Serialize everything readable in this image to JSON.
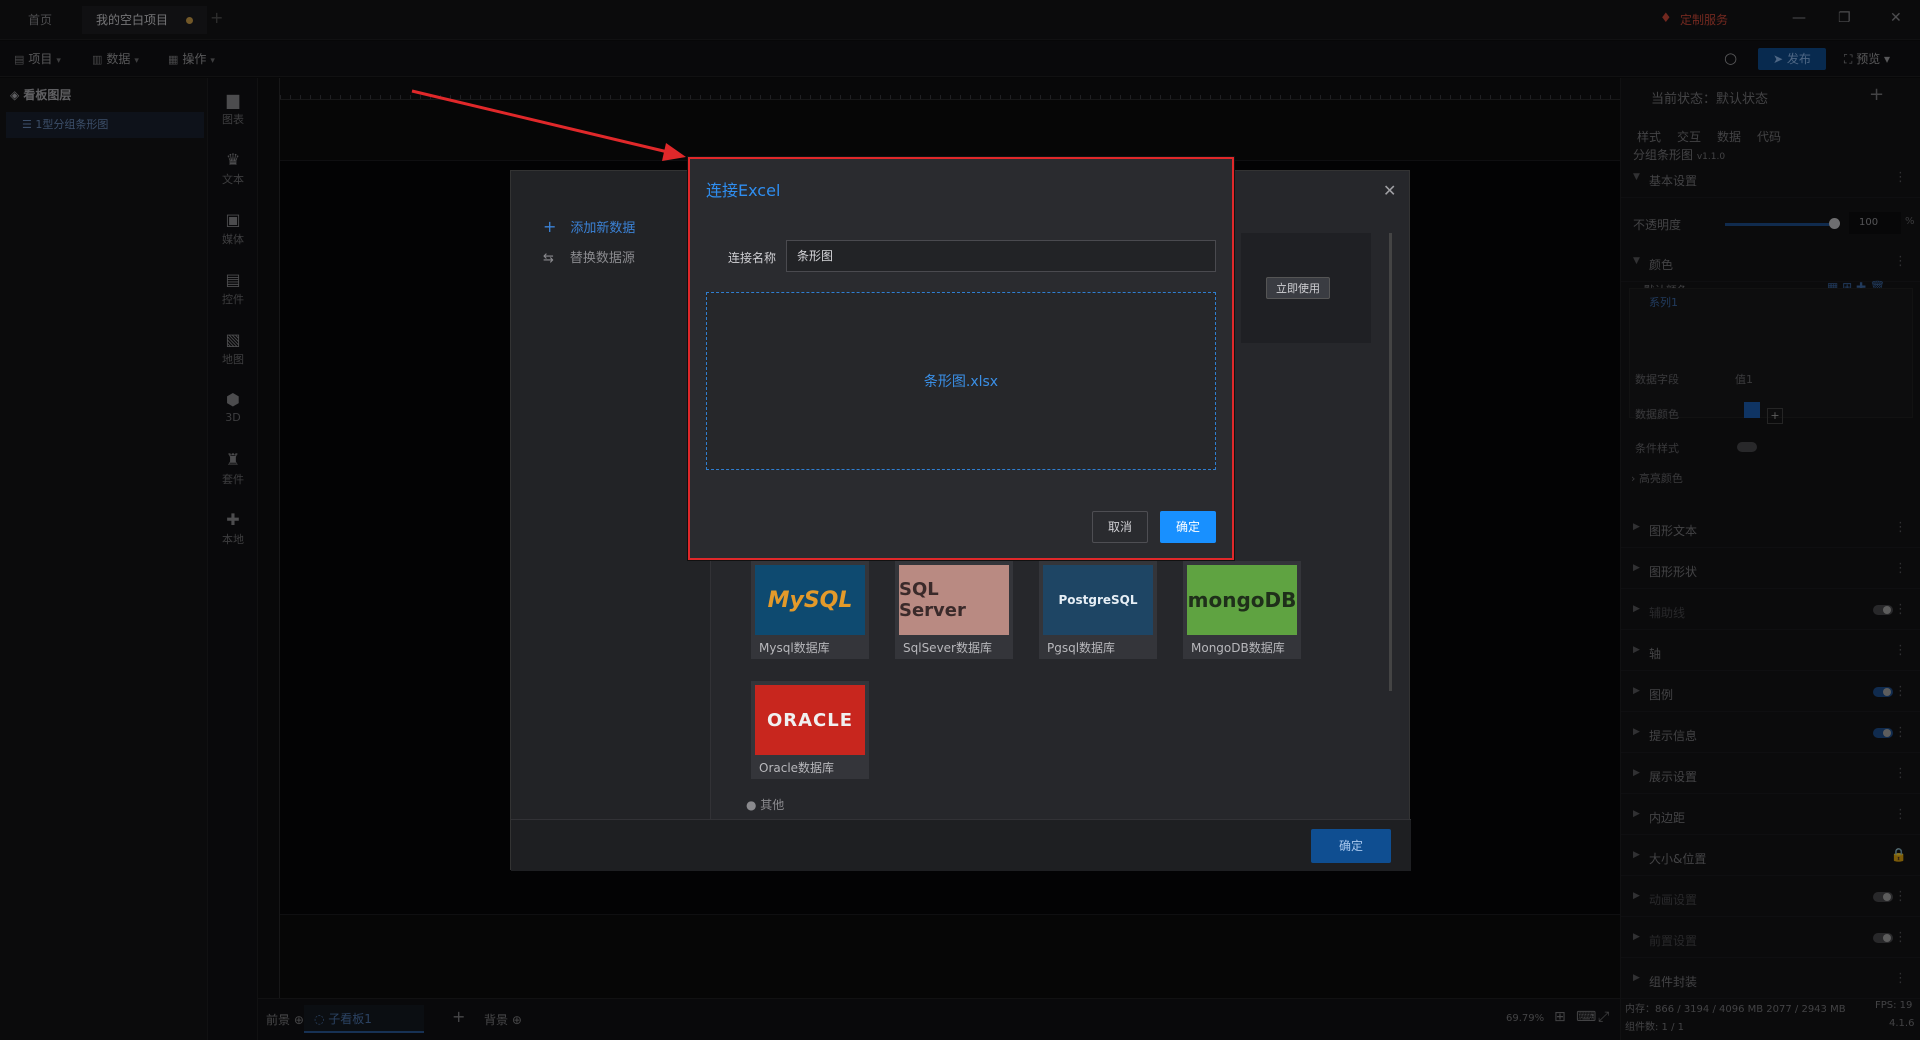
{
  "tabs": [
    {
      "label": "首页"
    },
    {
      "label": "我的空白项目"
    }
  ],
  "header": {
    "custom_service": "定制服务"
  },
  "toolbar": {
    "project": "项目",
    "data": "数据",
    "operation": "操作",
    "publish": "发布",
    "preview": "预览"
  },
  "layers": {
    "title": "看板图层",
    "item": "1型分组条形图"
  },
  "rail": [
    "图表",
    "文本",
    "媒体",
    "控件",
    "地图",
    "3D",
    "套件",
    "本地"
  ],
  "bottom": {
    "front": "前景",
    "page": "子看板1",
    "background": "背景",
    "zoom": "69.79%"
  },
  "right_panel": {
    "current_state": "当前状态：默认状态",
    "tabs": [
      "样式",
      "交互",
      "数据",
      "代码"
    ],
    "component_name": "分组条形图",
    "component_version": "v1.1.0",
    "basic_settings": "基本设置",
    "opacity_label": "不透明度",
    "opacity_value": "100",
    "opacity_unit": "%",
    "opacity_level": 1.0,
    "color": "颜色",
    "default_color": "默认颜色",
    "series_tab": "系列1",
    "data_field_label": "数据字段",
    "data_field_value": "值1",
    "data_color_label": "数据颜色",
    "data_color": "#1d5fb5",
    "condition_style_label": "条件样式",
    "highlight_color": "高亮颜色",
    "sections": [
      {
        "label": "图形文本",
        "dim": false,
        "toggle": null
      },
      {
        "label": "图形形状",
        "dim": false,
        "toggle": null
      },
      {
        "label": "辅助线",
        "dim": true,
        "toggle": "off"
      },
      {
        "label": "轴",
        "dim": false,
        "toggle": null
      },
      {
        "label": "图例",
        "dim": false,
        "toggle": "on"
      },
      {
        "label": "提示信息",
        "dim": false,
        "toggle": "on"
      },
      {
        "label": "展示设置",
        "dim": false,
        "toggle": null
      },
      {
        "label": "内边距",
        "dim": false,
        "toggle": null
      },
      {
        "label": "大小&位置",
        "dim": false,
        "toggle": null
      },
      {
        "label": "动画设置",
        "dim": true,
        "toggle": "off"
      },
      {
        "label": "前置设置",
        "dim": true,
        "toggle": "off"
      },
      {
        "label": "组件封装",
        "dim": false,
        "toggle": null
      }
    ],
    "memory": "内存：866 / 3194 / 4096 MB 2077 / 2943 MB",
    "fps": "FPS: 19",
    "component_count": "组件数: 1 / 1",
    "version": "4.1.6"
  },
  "ds_modal": {
    "add_new": "添加新数据",
    "replace": "替换数据源",
    "use_now": "立即使用",
    "confirm": "确定",
    "other": "其他",
    "databases": [
      {
        "key": "mysql",
        "logo": "MySQL",
        "name": "Mysql数据库"
      },
      {
        "key": "sqlserver",
        "logo": "SQL Server",
        "name": "SqlSever数据库"
      },
      {
        "key": "pgsql",
        "logo": "PostgreSQL",
        "name": "Pgsql数据库"
      },
      {
        "key": "mongo",
        "logo": "mongoDB",
        "name": "MongoDB数据库"
      },
      {
        "key": "oracle",
        "logo": "ORACLE",
        "name": "Oracle数据库"
      }
    ]
  },
  "excel_dialog": {
    "title": "连接Excel",
    "connection_name_label": "连接名称",
    "connection_name_value": "条形图",
    "file_name": "条形图.xlsx",
    "cancel": "取消",
    "ok": "确定"
  },
  "colors": {
    "accent": "#1890ff",
    "annotation": "#e0282a"
  }
}
